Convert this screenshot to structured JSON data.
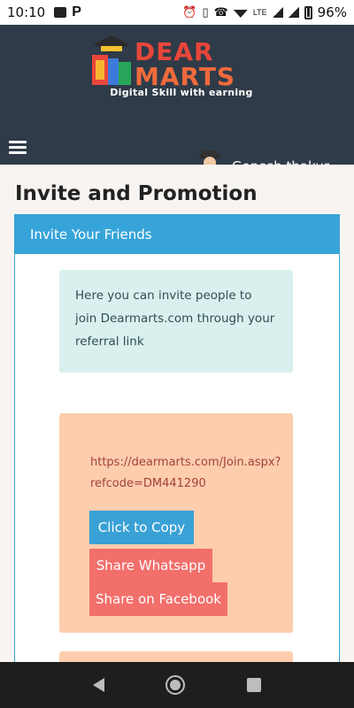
{
  "status_bar": {
    "time": "10:10",
    "left_icons": [
      "image-notification-icon",
      "p-notification-icon"
    ],
    "right_icons": [
      "alarm-icon",
      "vibrate-icon",
      "lte-call-icon",
      "wifi-icon",
      "lte-signal-icon",
      "signal-icon",
      "battery-icon"
    ],
    "lte_label": "LTE",
    "battery_pct": "96%"
  },
  "header": {
    "logo_line1": "DEAR",
    "logo_line2": "MARTS",
    "logo_tagline": "Digital Skill with earning",
    "user_name": "Gopesh thakur"
  },
  "page": {
    "title": "Invite and Promotion"
  },
  "panel": {
    "heading": "Invite Your Friends",
    "info_text": "Here you can invite people to join Dearmarts.com through your referral link",
    "referral_link": "https://dearmarts.com/Join.aspx?refcode=DM441290",
    "copy_label": "Click to Copy",
    "whatsapp_label": "Share Whatsapp",
    "facebook_label": "Share on Facebook"
  },
  "colors": {
    "header_bg": "#2f3b48",
    "accent_blue": "#37a4d9",
    "share_red": "#f26f6b",
    "info_bg": "#d9f0ef",
    "share_bg": "#fdcdad"
  }
}
